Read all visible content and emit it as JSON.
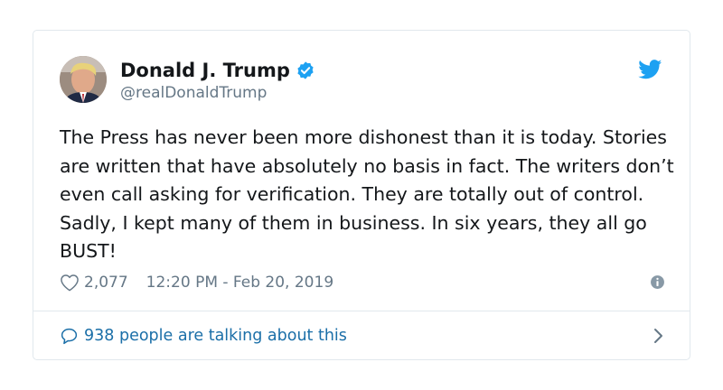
{
  "tweet": {
    "author_name": "Donald J. Trump",
    "author_handle": "@realDonaldTrump",
    "verified_icon": "verified-badge-icon",
    "brand_icon": "twitter-bird-icon",
    "text": "The Press has never been more dishonest than it is today. Stories are written that have absolutely no basis in fact. The writers don’t even call asking for verification. They are totally out of control. Sadly, I kept many of them in business. In six years, they all go BUST!",
    "like_count": "2,077",
    "timestamp": "12:20 PM - Feb 20, 2019",
    "talking_label": "938 people are talking about this"
  },
  "colors": {
    "twitter_blue": "#1da1f2",
    "link_blue": "#1b6fa8",
    "secondary_text": "#657786",
    "border": "#e1e8ed"
  }
}
